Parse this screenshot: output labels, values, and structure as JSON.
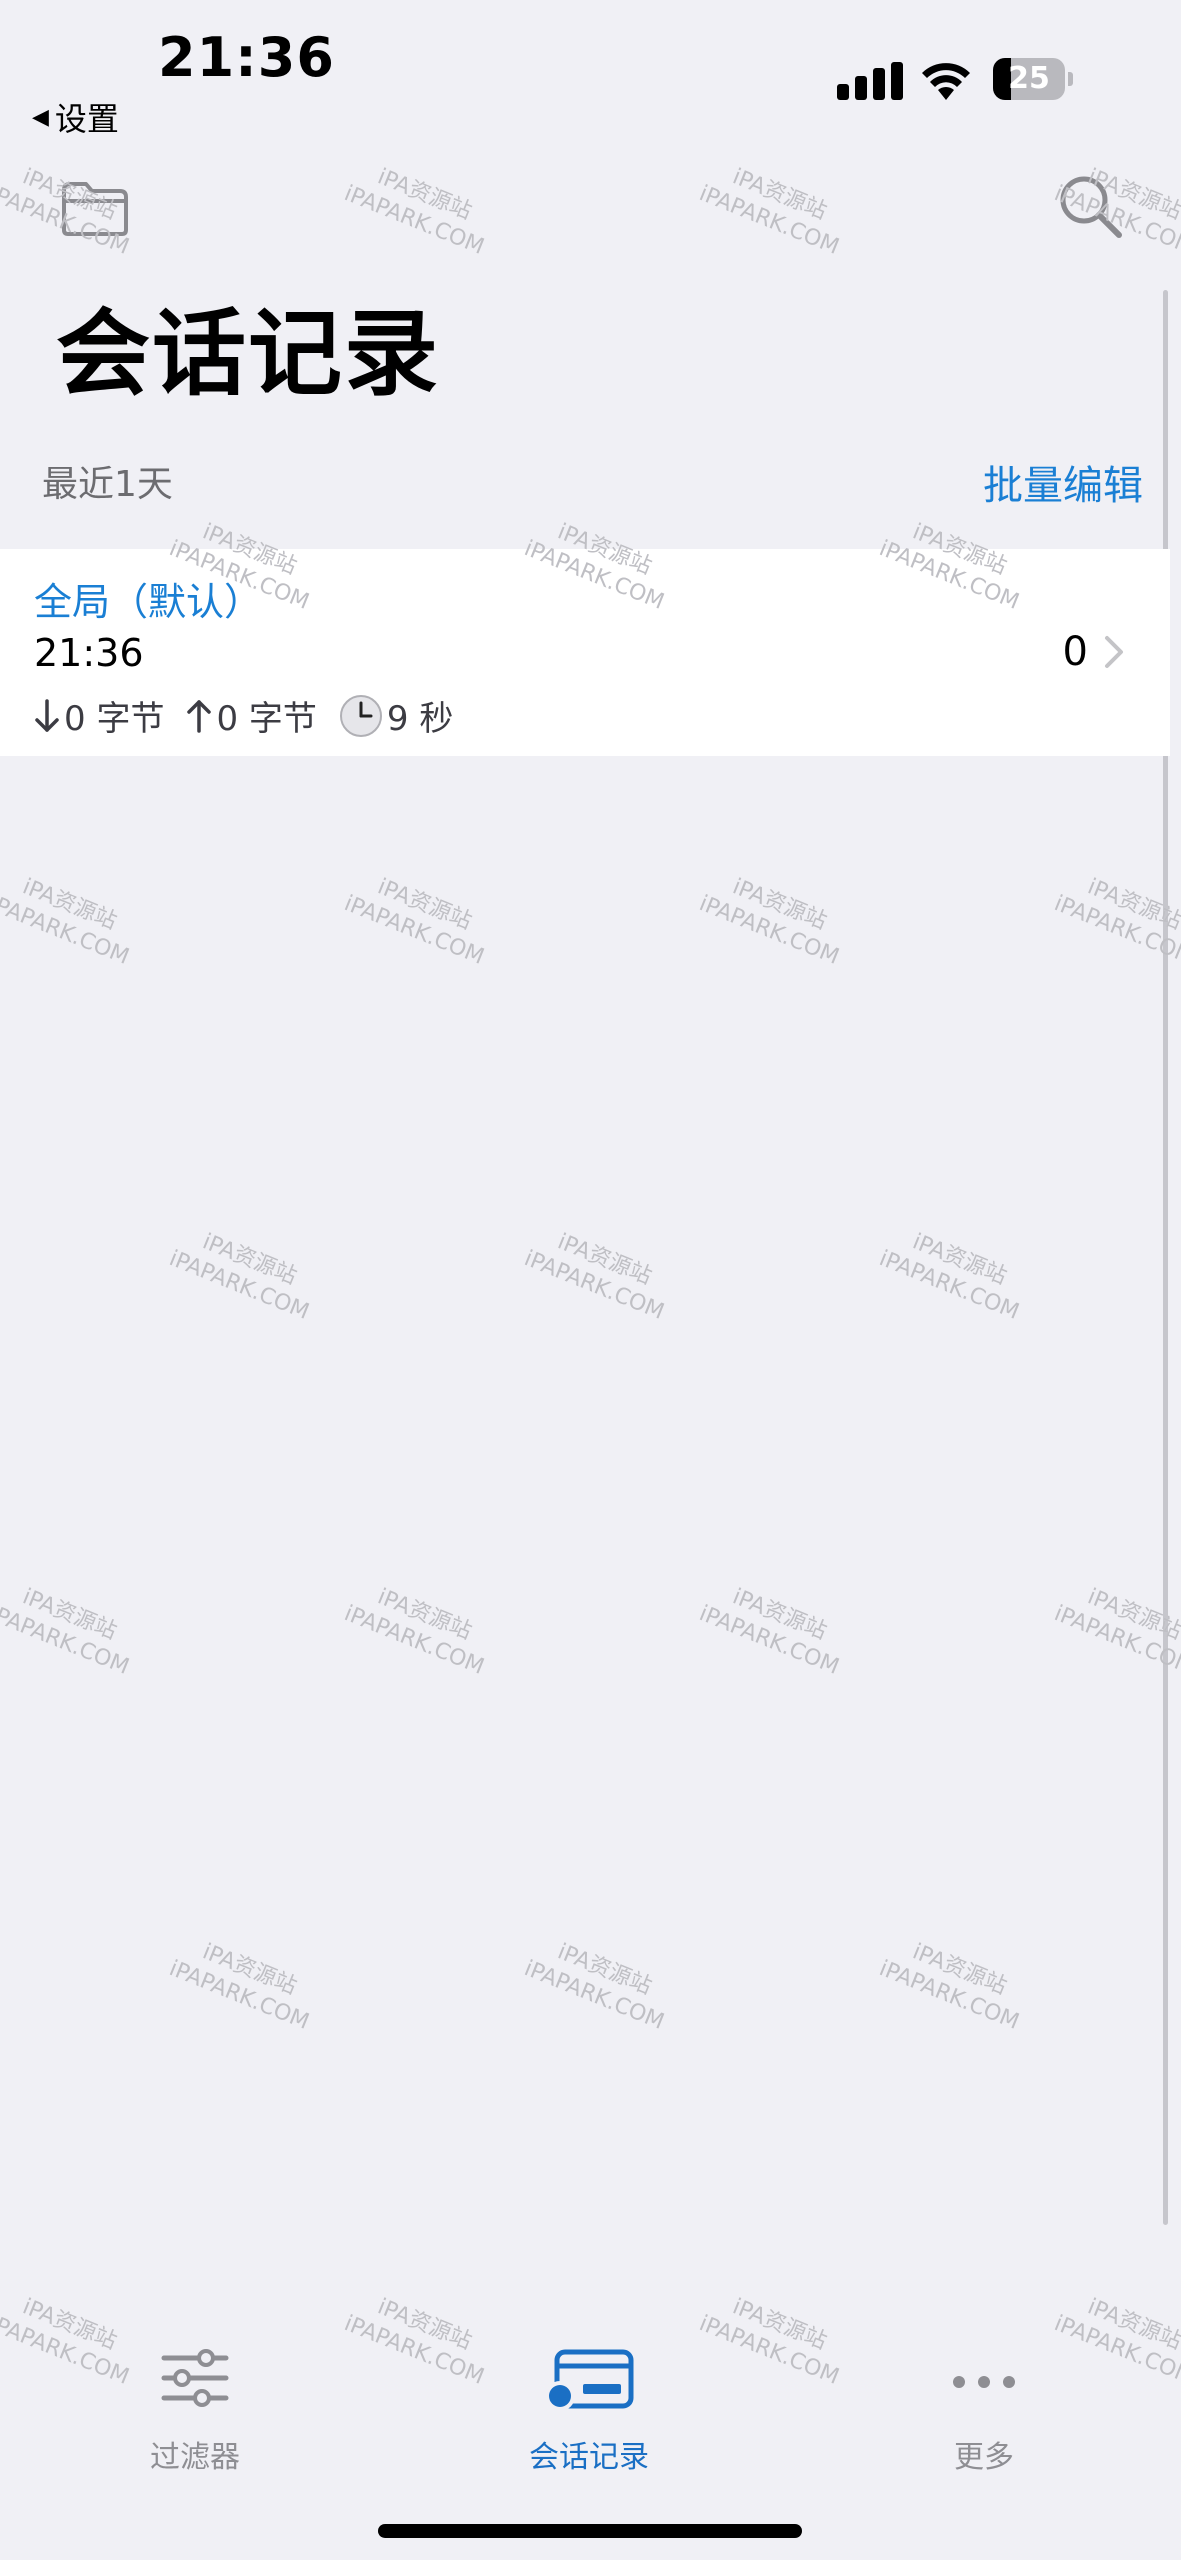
{
  "status_bar": {
    "time": "21:36",
    "back_label": "设置",
    "battery_level": "25",
    "battery_fraction": 0.25
  },
  "nav": {
    "title": "会话记录",
    "folder_icon": "folder-icon",
    "search_icon": "search-icon"
  },
  "section": {
    "header": "最近1天",
    "batch_edit": "批量编辑"
  },
  "sessions": [
    {
      "title": "全局（默认）",
      "time": "21:36",
      "count": "0",
      "download": "0 字节",
      "upload": "0 字节",
      "duration": "9 秒"
    }
  ],
  "tab_bar": {
    "tabs": [
      {
        "label": "过滤器",
        "icon": "sliders-icon",
        "active": false
      },
      {
        "label": "会话记录",
        "icon": "session-card-icon",
        "active": true
      },
      {
        "label": "更多",
        "icon": "more-icon",
        "active": false
      }
    ]
  },
  "watermark": {
    "line1": "iPA资源站",
    "line2": "iPAPARK.COM"
  },
  "colors": {
    "accent": "#1a7fd4",
    "background": "#f0f0f5",
    "row_background": "#ffffff",
    "secondary_text": "#6c6c70"
  }
}
